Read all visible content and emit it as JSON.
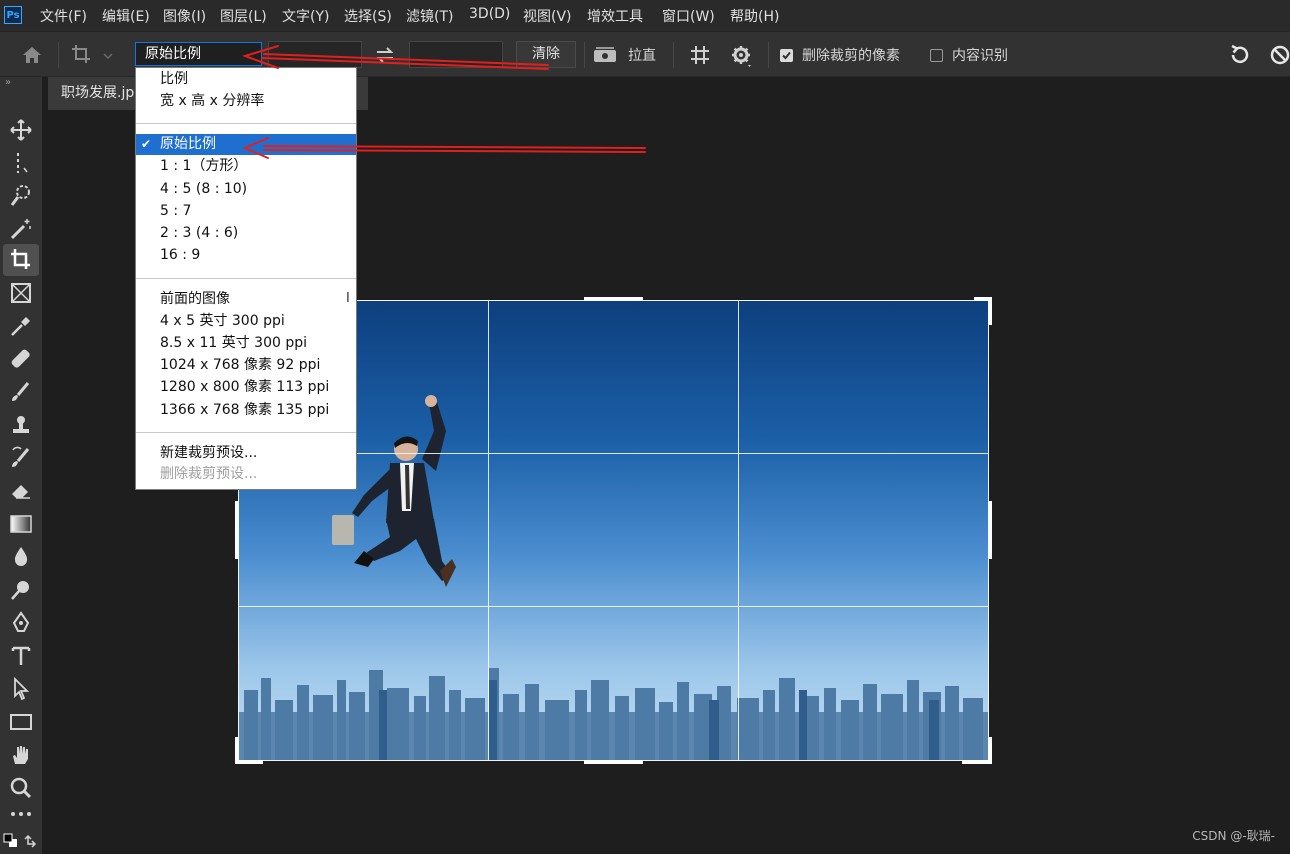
{
  "app": {
    "logo": "Ps"
  },
  "menu": [
    "文件(F)",
    "编辑(E)",
    "图像(I)",
    "图层(L)",
    "文字(Y)",
    "选择(S)",
    "滤镜(T)",
    "3D(D)",
    "视图(V)",
    "增效工具",
    "窗口(W)",
    "帮助(H)"
  ],
  "options": {
    "ratio_value": "原始比例",
    "width_value": "",
    "height_value": "",
    "clear_label": "清除",
    "straighten_label": "拉直",
    "delete_pixels_label": "删除裁剪的像素",
    "delete_pixels_checked": true,
    "content_aware_label": "内容识别",
    "content_aware_checked": false
  },
  "document": {
    "tab_title": "职场发展.jpg"
  },
  "dropdown": {
    "group1": [
      "比例",
      "宽 x 高 x 分辨率"
    ],
    "group2": [
      "原始比例",
      "1 : 1（方形）",
      "4 : 5 (8 : 10)",
      "5 : 7",
      "2 : 3 (4 : 6)",
      "16 : 9"
    ],
    "selected_index": 0,
    "group3": [
      "前面的图像",
      "4 x 5 英寸 300 ppi",
      "8.5 x 11 英寸 300 ppi",
      "1024 x 768 像素 92 ppi",
      "1280 x 800 像素 113 ppi",
      "1366 x 768 像素 135 ppi"
    ],
    "group4_enabled": "新建裁剪预设...",
    "group4_disabled": "删除裁剪预设...",
    "cursor_glyph": "I"
  },
  "watermark": "CSDN @-耿瑞-",
  "colors": {
    "accent": "#1473e6",
    "annotation_arrow": "#e0201e",
    "selected_row": "#1f6fd0"
  }
}
